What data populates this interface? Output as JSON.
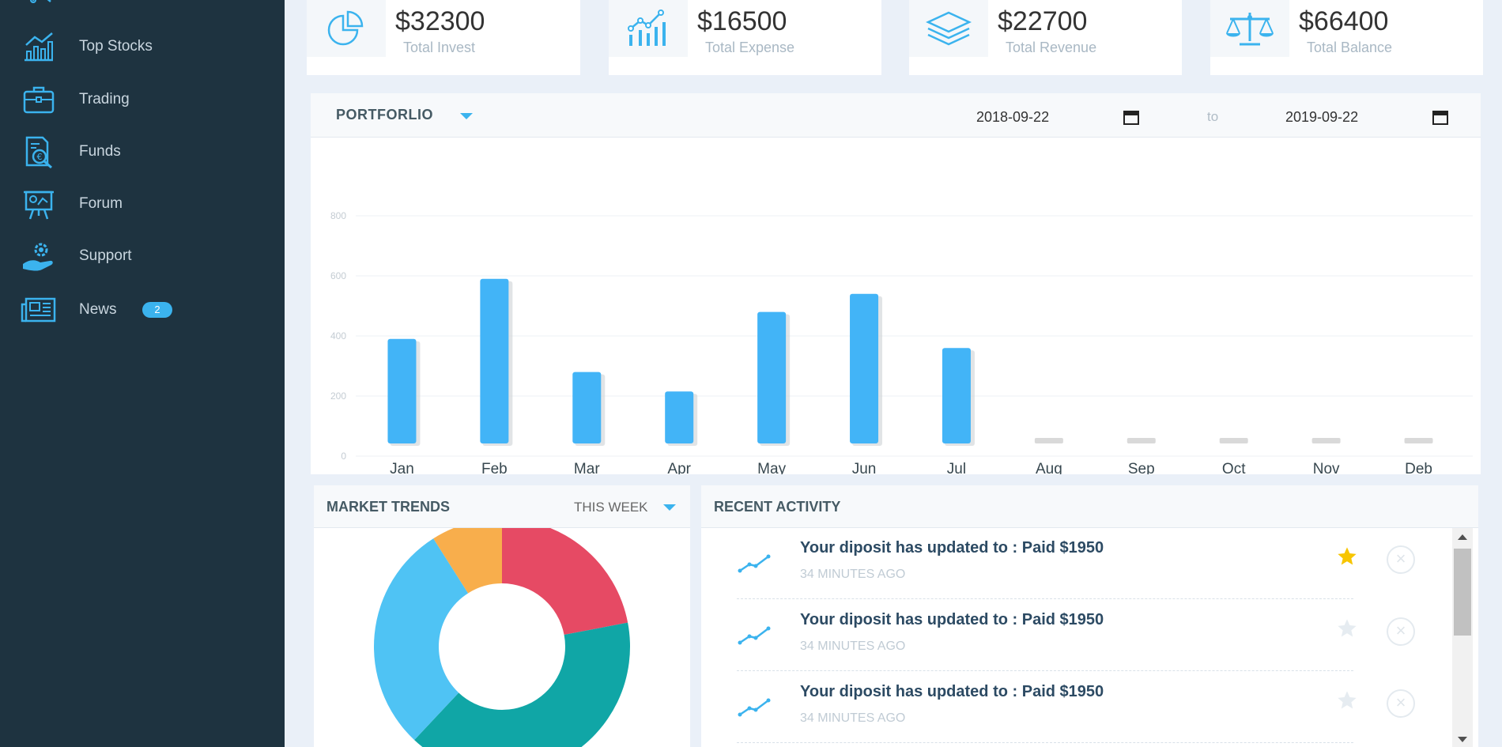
{
  "sidebar": {
    "items": [
      {
        "label": "Top Stocks",
        "icon": "line-chart-icon"
      },
      {
        "label": "Trading",
        "icon": "briefcase-icon"
      },
      {
        "label": "Funds",
        "icon": "funds-report-icon"
      },
      {
        "label": "Forum",
        "icon": "presentation-board-icon"
      },
      {
        "label": "Support",
        "icon": "support-hand-gear-icon"
      },
      {
        "label": "News",
        "icon": "newspaper-icon",
        "badge": "2"
      }
    ]
  },
  "stats": [
    {
      "value": "$32300",
      "caption": "Total Invest",
      "icon": "pie-chart-icon"
    },
    {
      "value": "$16500",
      "caption": "Total Expense",
      "icon": "bar-trend-icon"
    },
    {
      "value": "$22700",
      "caption": "Total Revenue",
      "icon": "layers-icon"
    },
    {
      "value": "$66400",
      "caption": "Total Balance",
      "icon": "scale-icon"
    }
  ],
  "portfolio": {
    "title": "PORTFORLIO",
    "date_from": "2018-09-22",
    "date_to": "2019-09-22",
    "to_label": "to"
  },
  "chart_data": {
    "type": "bar",
    "categories": [
      "Jan",
      "Feb",
      "Mar",
      "Apr",
      "May",
      "Jun",
      "Jul",
      "Aug",
      "Sep",
      "Oct",
      "Nov",
      "Deb"
    ],
    "values": [
      390,
      590,
      280,
      215,
      480,
      540,
      360,
      0,
      0,
      0,
      0,
      0
    ],
    "yticks": [
      0,
      200,
      400,
      600,
      800
    ],
    "ylim": [
      0,
      800
    ],
    "grid": true,
    "colors": {
      "bar": "#42b4f7",
      "empty_bar": "#d9d9d9"
    }
  },
  "market": {
    "title": "MARKET TRENDS",
    "period": "THIS WEEK",
    "donut": [
      {
        "value": 22,
        "color": "#e64a64"
      },
      {
        "value": 40,
        "color": "#10a6a6"
      },
      {
        "value": 29,
        "color": "#4fc3f4"
      },
      {
        "value": 9,
        "color": "#f8ae4c"
      }
    ]
  },
  "activity": {
    "title": "RECENT ACTIVITY",
    "items": [
      {
        "message": "Your diposit has updated to : Paid $1950",
        "time": "34 MINUTES AGO",
        "starred": true
      },
      {
        "message": "Your diposit has updated to : Paid $1950",
        "time": "34 MINUTES AGO",
        "starred": false
      },
      {
        "message": "Your diposit has updated to : Paid $1950",
        "time": "34 MINUTES AGO",
        "starred": false
      }
    ],
    "close_glyph": "×"
  }
}
